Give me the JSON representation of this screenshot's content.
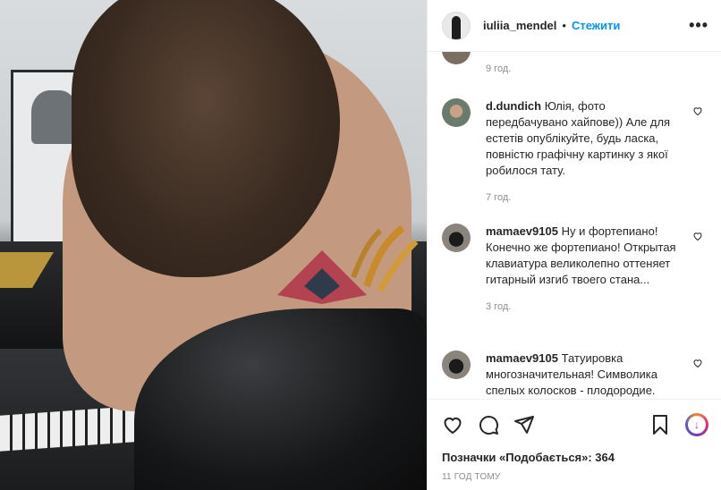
{
  "header": {
    "username": "iuliia_mendel",
    "separator": "•",
    "follow_label": "Стежити",
    "more_label": "•••"
  },
  "top_comment": {
    "time": "9 год."
  },
  "comments": [
    {
      "user": "d.dundich",
      "text": "Юлія, фото передбачувано хайпове)) Але для естетів опублікуйте, будь ласка, повністю графічну картинку з якої робилося тату.",
      "time": "7 год."
    },
    {
      "user": "mamaev9105",
      "text": "Ну и фортепиано! Конечно же фортепиано! Открытая клавиатура великолепно оттеняет гитарный изгиб твоего стана...",
      "time": "3 год."
    },
    {
      "user": "mamaev9105",
      "text": "Татуировка многозначительная! Символика спелых колосков - плодородие.",
      "time": ""
    }
  ],
  "likes_text": "Позначки «Подобається»: 364",
  "posted_ago": "11 ГОД ТОМУ",
  "icons": [
    "heart-icon",
    "comment-icon",
    "share-icon",
    "bookmark-icon",
    "instagram-badge-icon"
  ]
}
